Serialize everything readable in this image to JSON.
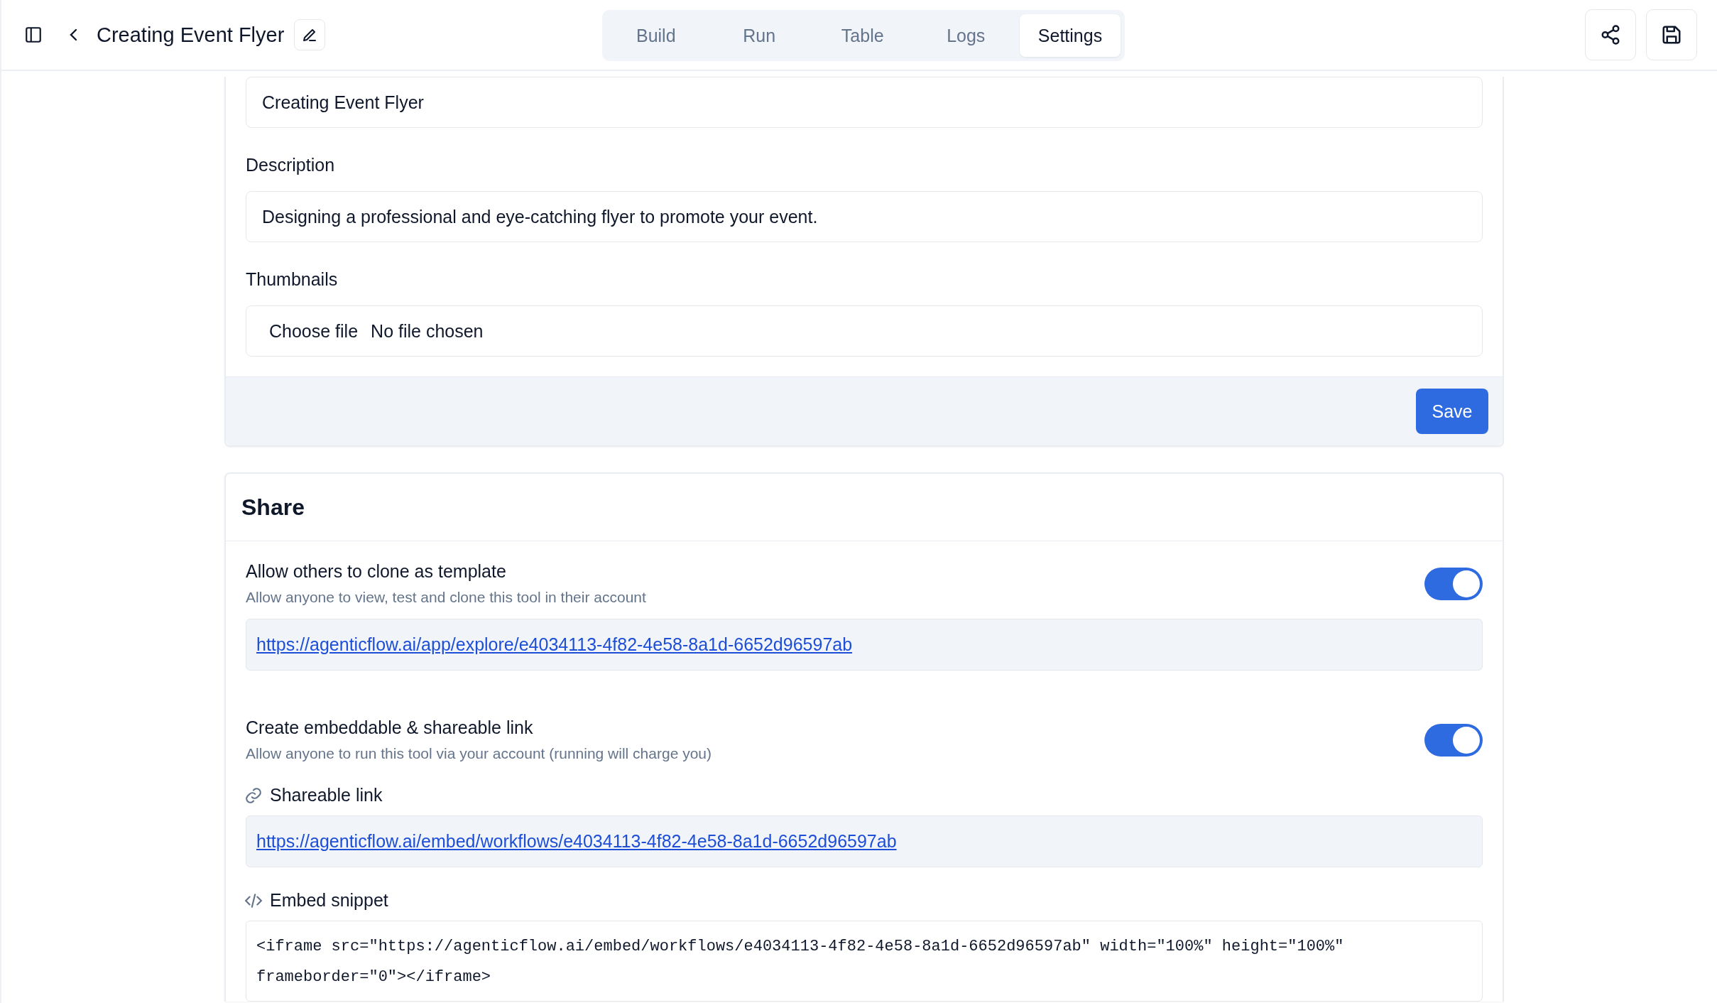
{
  "header": {
    "title": "Creating Event Flyer"
  },
  "tabs": [
    {
      "label": "Build",
      "selected": false
    },
    {
      "label": "Run",
      "selected": false
    },
    {
      "label": "Table",
      "selected": false
    },
    {
      "label": "Logs",
      "selected": false
    },
    {
      "label": "Settings",
      "selected": true
    }
  ],
  "settings_form": {
    "name_value": "Creating Event Flyer",
    "description_label": "Description",
    "description_value": "Designing a professional and eye-catching flyer to promote your event.",
    "thumbnails_label": "Thumbnails",
    "file_button": "Choose file",
    "file_status": "No file chosen",
    "save_button": "Save"
  },
  "share": {
    "title": "Share",
    "options": [
      {
        "title": "Allow others to clone as template",
        "description": "Allow anyone to view, test and clone this tool in their account",
        "on": true,
        "sections": [
          {
            "kind": "link",
            "value": "https://agenticflow.ai/app/explore/e4034113-4f82-4e58-8a1d-6652d96597ab"
          }
        ]
      },
      {
        "title": "Create embeddable & shareable link",
        "description": "Allow anyone to run this tool via your account (running will charge you)",
        "on": true,
        "sections": [
          {
            "kind": "link",
            "label": "Shareable link",
            "value": "https://agenticflow.ai/embed/workflows/e4034113-4f82-4e58-8a1d-6652d96597ab"
          },
          {
            "kind": "code",
            "label": "Embed snippet",
            "value": "<iframe src=\"https://agenticflow.ai/embed/workflows/e4034113-4f82-4e58-8a1d-6652d96597ab\" width=\"100%\" height=\"100%\" frameborder=\"0\"></iframe>"
          }
        ]
      }
    ]
  }
}
